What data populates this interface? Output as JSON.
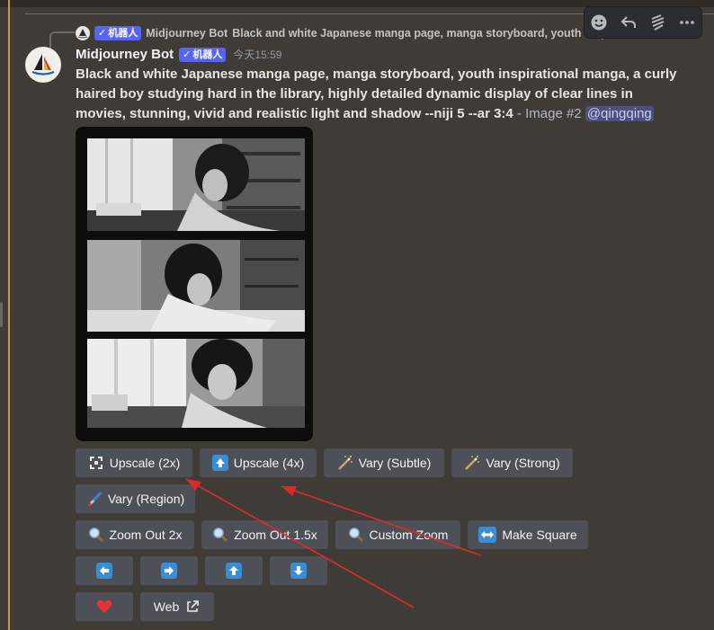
{
  "reply": {
    "bot_tag": "机器人",
    "name": "Midjourney Bot",
    "text": "Black and white Japanese manga page, manga storyboard, youth inspiration"
  },
  "message": {
    "author": "Midjourney Bot",
    "bot_tag": "机器人",
    "timestamp": "今天15:59",
    "prompt": "Black and white Japanese manga page, manga storyboard, youth inspirational manga, a curly haired boy studying hard in the library, highly detailed dynamic display of clear lines in movies, stunning, vivid and realistic light and shadow --niji 5 --ar 3:4",
    "suffix": " - Image #2 ",
    "mention": "@qingqing"
  },
  "toolbar": {
    "icons": [
      "emoji-icon",
      "reply-icon",
      "thread-icon",
      "more-icon"
    ]
  },
  "buttons": {
    "upscale_2x": "Upscale (2x)",
    "upscale_4x": "Upscale (4x)",
    "vary_subtle": "Vary (Subtle)",
    "vary_strong": "Vary (Strong)",
    "vary_region": "Vary (Region)",
    "zoom_out_2x": "Zoom Out 2x",
    "zoom_out_15x": "Zoom Out 1.5x",
    "custom_zoom": "Custom Zoom",
    "make_square": "Make Square",
    "web": "Web"
  },
  "colors": {
    "background": "#3f3b36",
    "button": "#4e5058",
    "bot_tag": "#5865f2",
    "annotation_arrow": "#e02a2a",
    "heart": "#e3323c",
    "blue_icon": "#3b8ed4"
  }
}
